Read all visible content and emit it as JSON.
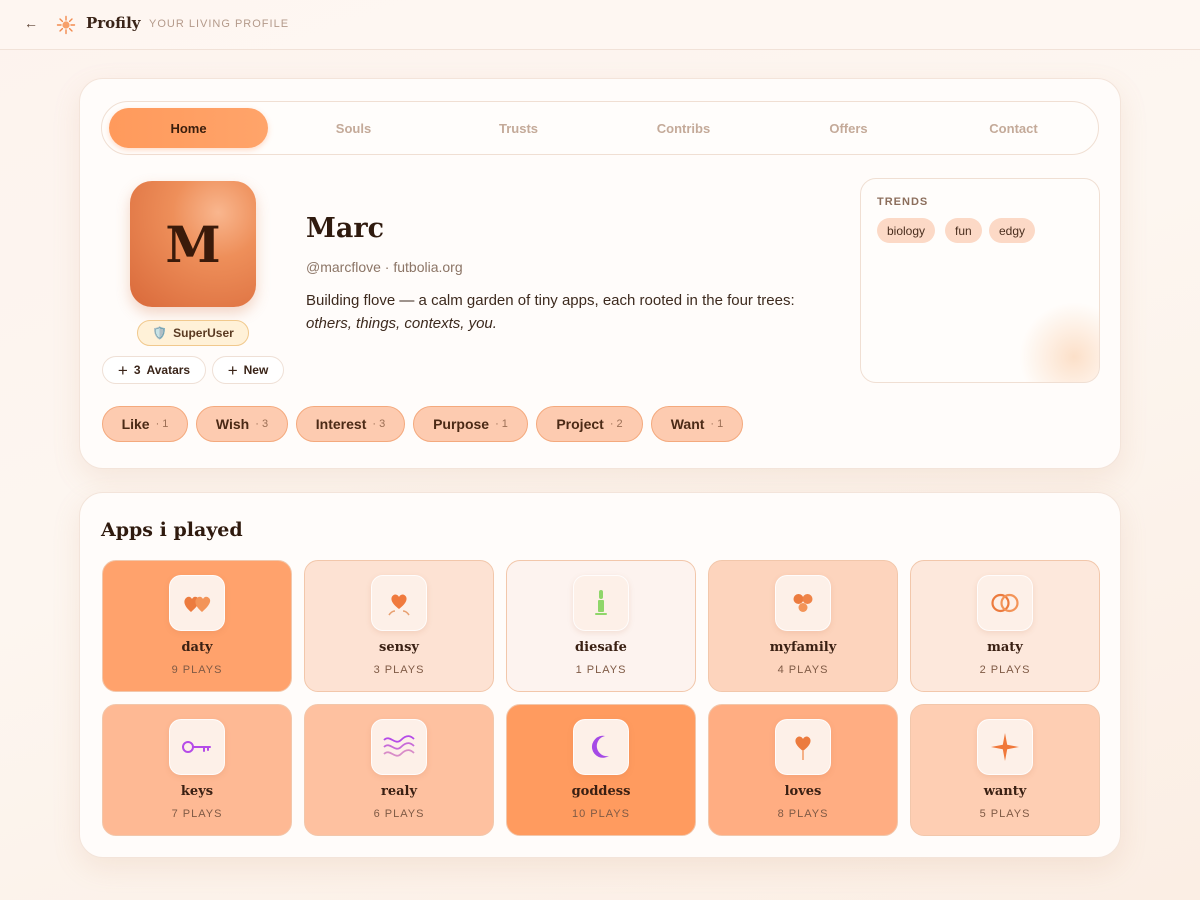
{
  "topbar": {
    "back_label": "←",
    "brand": "Profily",
    "tagline": "YOUR LIVING PROFILE"
  },
  "tabs": [
    {
      "label": "Home",
      "active": true
    },
    {
      "label": "Souls"
    },
    {
      "label": "Trusts"
    },
    {
      "label": "Contribs"
    },
    {
      "label": "Offers"
    },
    {
      "label": "Contact"
    }
  ],
  "profile": {
    "avatar_letter": "M",
    "badge": {
      "icon": "shield-icon",
      "glyph": "🛡️",
      "label": "SuperUser"
    },
    "avatars_button": {
      "count": "3",
      "label": "Avatars"
    },
    "new_button": {
      "label": "New"
    },
    "name": "Marc",
    "handle": "@marcflove · futbolia.org",
    "bio_prefix": "Building flove — a calm garden of tiny apps, each rooted in the four trees: ",
    "bio_emphasis": "others, things, contexts, you."
  },
  "trends": {
    "title": "TRENDS",
    "tags": [
      "biology",
      "fun",
      "edgy"
    ]
  },
  "intents": [
    {
      "label": "Like",
      "count": "· 1"
    },
    {
      "label": "Wish",
      "count": "· 3"
    },
    {
      "label": "Interest",
      "count": "· 3"
    },
    {
      "label": "Purpose",
      "count": "· 1"
    },
    {
      "label": "Project",
      "count": "· 2"
    },
    {
      "label": "Want",
      "count": "· 1"
    }
  ],
  "apps_section": {
    "title": "Apps i played",
    "apps": [
      {
        "name": "daty",
        "plays": "9 PLAYS",
        "icon": "two-hearts-icon",
        "bg": "#ffa26c"
      },
      {
        "name": "sensy",
        "plays": "3 PLAYS",
        "icon": "heart-sprout-icon",
        "bg": "#fde2d3"
      },
      {
        "name": "diesafe",
        "plays": "1 PLAYS",
        "icon": "candle-icon",
        "bg": "#fdf3ef"
      },
      {
        "name": "myfamily",
        "plays": "4 PLAYS",
        "icon": "family-dots-icon",
        "bg": "#fdd4bd"
      },
      {
        "name": "maty",
        "plays": "2 PLAYS",
        "icon": "rings-icon",
        "bg": "#fde8dc"
      },
      {
        "name": "keys",
        "plays": "7 PLAYS",
        "icon": "key-icon",
        "bg": "#feb994"
      },
      {
        "name": "realy",
        "plays": "6 PLAYS",
        "icon": "waves-icon",
        "bg": "#fec1a0"
      },
      {
        "name": "goddess",
        "plays": "10 PLAYS",
        "icon": "moon-icon",
        "bg": "#ff9b5f"
      },
      {
        "name": "loves",
        "plays": "8 PLAYS",
        "icon": "heart-stem-icon",
        "bg": "#ffad82"
      },
      {
        "name": "wanty",
        "plays": "5 PLAYS",
        "icon": "sparkle-icon",
        "bg": "#feceb3"
      }
    ]
  }
}
